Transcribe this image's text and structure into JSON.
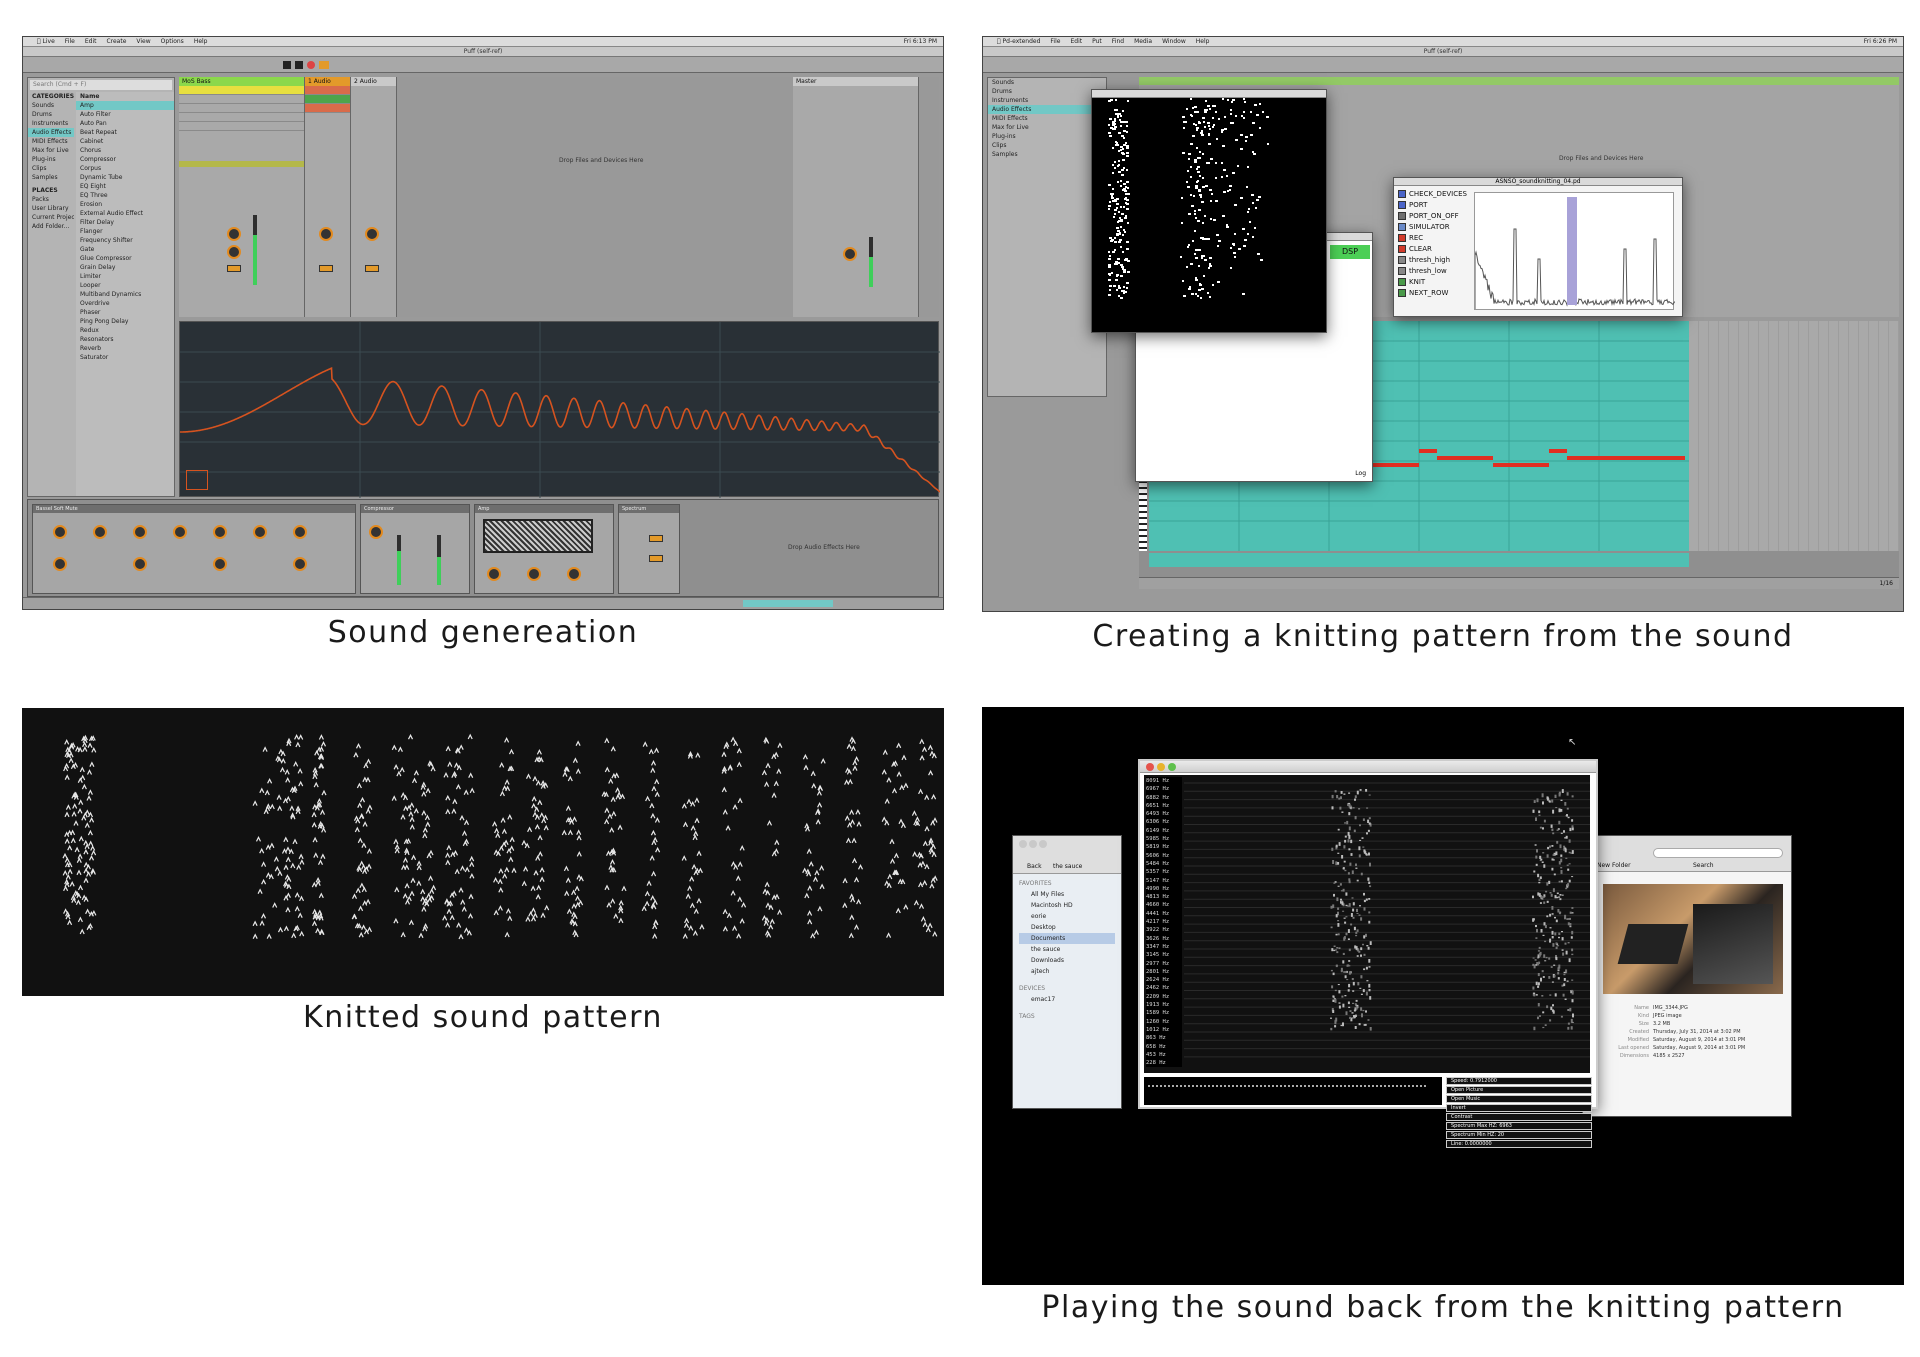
{
  "captions": {
    "top_left": "Sound genereation",
    "top_right": "Creating a knitting pattern from the sound",
    "bottom_left": "Knitted sound pattern",
    "bottom_right": "Playing the sound back from the knitting pattern"
  },
  "ableton": {
    "menu": [
      "Live",
      "File",
      "Edit",
      "Create",
      "View",
      "Options",
      "Help"
    ],
    "window_title": "Puff (self-ref)",
    "clock": "Fri 6:13 PM",
    "search_placeholder": "Search (Cmd + F)",
    "categories_header": "CATEGORIES",
    "categories": [
      "Sounds",
      "Drums",
      "Instruments",
      "Audio Effects",
      "MIDI Effects",
      "Max for Live",
      "Plug-ins",
      "Clips",
      "Samples"
    ],
    "places_header": "PLACES",
    "places": [
      "Packs",
      "User Library",
      "Current Project",
      "Add Folder..."
    ],
    "name_header": "Name",
    "browser_items": [
      "Amp",
      "Auto Filter",
      "Auto Pan",
      "Beat Repeat",
      "Cabinet",
      "Chorus",
      "Compressor",
      "Corpus",
      "Dynamic Tube",
      "EQ Eight",
      "EQ Three",
      "Erosion",
      "External Audio Effect",
      "Filter Delay",
      "Flanger",
      "Frequency Shifter",
      "Gate",
      "Glue Compressor",
      "Grain Delay",
      "Limiter",
      "Looper",
      "Multiband Dynamics",
      "Overdrive",
      "Phaser",
      "Ping Pong Delay",
      "Redux",
      "Resonators",
      "Reverb",
      "Saturator"
    ],
    "tracks": [
      "MoS Bass",
      "1 Audio",
      "2 Audio"
    ],
    "master_label": "Master",
    "drop_session": "Drop Files and Devices Here",
    "drop_devices": "Drop Audio Effects Here",
    "devices": [
      "Bassel Soft Mute",
      "Compressor",
      "Amp",
      "Spectrum"
    ],
    "chart_mode": "analyzer"
  },
  "pd": {
    "menu": [
      "Pd-extended",
      "File",
      "Edit",
      "Put",
      "Find",
      "Media",
      "Window",
      "Help"
    ],
    "window_title": "Puff (self-ref)",
    "clock": "Fri 6:26 PM",
    "dsp_label": "DSP",
    "patch_title": "ASNSO_soundknitting_04.pd",
    "patch_items": [
      "CHECK_DEVICES",
      "PORT",
      "PORT_ON_OFF",
      "SIMULATOR",
      "REC",
      "CLEAR",
      "thresh_high",
      "thresh_low",
      "KNIT",
      "NEXT_ROW"
    ],
    "patch_colors": [
      "#4a64c8",
      "#4a64c8",
      "#6e6e6e",
      "#6a8ac8",
      "#d23a2a",
      "#d23a2a",
      "#888888",
      "#888888",
      "#4a9a4a",
      "#4a9a4a"
    ],
    "log_label": "Log",
    "time_ratio": "1/16"
  },
  "player": {
    "finder_favorites_header": "FAVORITES",
    "finder_items": [
      "All My Files",
      "Macintosh HD",
      "eorie",
      "Desktop",
      "Documents",
      "the sauce",
      "Downloads",
      "ajtech"
    ],
    "finder_devices_header": "DEVICES",
    "finder_devices": [
      "emac17"
    ],
    "finder_tags_header": "TAGS",
    "finder_toolbar": [
      "Back",
      "the sauce"
    ],
    "hz_labels": [
      "8091 Hz",
      "6967 Hz",
      "6882 Hz",
      "6651 Hz",
      "6493 Hz",
      "6306 Hz",
      "6149 Hz",
      "5985 Hz",
      "5819 Hz",
      "5606 Hz",
      "5484 Hz",
      "5357 Hz",
      "5147 Hz",
      "4990 Hz",
      "4813 Hz",
      "4660 Hz",
      "4441 Hz",
      "4217 Hz",
      "3922 Hz",
      "3626 Hz",
      "3347 Hz",
      "3145 Hz",
      "2977 Hz",
      "2801 Hz",
      "2624 Hz",
      "2462 Hz",
      "2209 Hz",
      "1913 Hz",
      "1589 Hz",
      "1260 Hz",
      "1012 Hz",
      "863 Hz",
      "658 Hz",
      "453 Hz",
      "228 Hz"
    ],
    "controls": [
      "Speed: 0.7912000",
      "Open Picture",
      "Open Music",
      "Invert",
      "Contrast",
      "Spectrum Max HZ: 6963",
      "Spectrum Min HZ: 20",
      "Line: 0.0000000"
    ],
    "preview_toolbar": [
      "New Folder",
      "Search"
    ],
    "info_keys": [
      "Name",
      "Kind",
      "Size",
      "Created",
      "Modified",
      "Last opened",
      "Dimensions"
    ],
    "info_values": [
      "IMG_3344.JPG",
      "JPEG image",
      "3.2 MB",
      "Thursday, July 31, 2014 at 3:02 PM",
      "Saturday, August 9, 2014 at 3:01 PM",
      "Saturday, August 9, 2014 at 3:01 PM",
      "4185 x 2527"
    ]
  }
}
